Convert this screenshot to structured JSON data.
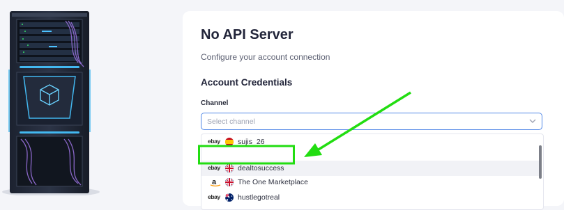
{
  "page": {
    "title": "No API Server",
    "subtitle": "Configure your account connection",
    "section_title": "Account Credentials"
  },
  "channel_field": {
    "label": "Channel",
    "placeholder": "Select channel"
  },
  "channel_options": [
    {
      "marketplace": "ebay",
      "flag": "spain",
      "name": "sujis_26"
    },
    {
      "marketplace": "ebay",
      "flag": "uk",
      "name": "dealtosuccess",
      "highlighted": true
    },
    {
      "marketplace": "amazon",
      "flag": "uk",
      "name": "The One Marketplace"
    },
    {
      "marketplace": "ebay",
      "flag": "australia",
      "name": "hustlegotreal"
    }
  ],
  "marketplace_marks": {
    "ebay": "ebay",
    "amazon": "a"
  },
  "colors": {
    "accent": "#4f86e6",
    "annotation_green": "#22dd11",
    "server_glow": "#43b8f0",
    "background": "#f4f5f9"
  }
}
